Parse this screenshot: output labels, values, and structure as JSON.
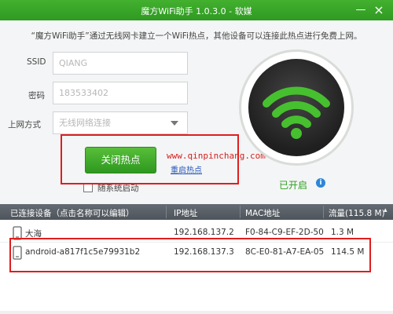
{
  "window": {
    "title": "魔方WiFi助手 1.0.3.0 - 软媒",
    "minimize": "—",
    "close": "×"
  },
  "subtitle": "“魔方WiFi助手”通过无线网卡建立一个WiFi热点，其他设备可以连接此热点进行免费上网。",
  "form": {
    "ssid_label": "SSID",
    "ssid_value": "QIANG",
    "password_label": "密码",
    "password_value": "183533402",
    "mode_label": "上网方式",
    "mode_value": "无线网络连接"
  },
  "actions": {
    "toggle_label": "关闭热点",
    "restart_label": "重启热点",
    "autostart_label": "随系统启动",
    "autostart_checked": false
  },
  "watermark": "www.qinpinchang.com",
  "status": {
    "text": "已开启",
    "info": "i",
    "color": "#2f9e22"
  },
  "table": {
    "headers": {
      "device": "已连接设备（点击名称可以编辑）",
      "ip": "IP地址",
      "mac": "MAC地址",
      "traffic": "流量(115.8 M)"
    },
    "rows": [
      {
        "name": "大海",
        "ip": "192.168.137.2",
        "mac": "F0-84-C9-EF-2D-50",
        "traffic": "1.3 M"
      },
      {
        "name": "android-a817f1c5e79931b2",
        "ip": "192.168.137.3",
        "mac": "8C-E0-81-A7-EA-05",
        "traffic": "114.5 M"
      }
    ]
  },
  "colors": {
    "accent_green": "#3db12e",
    "highlight_red": "#e01e1e",
    "header_gray": "#565c63"
  }
}
